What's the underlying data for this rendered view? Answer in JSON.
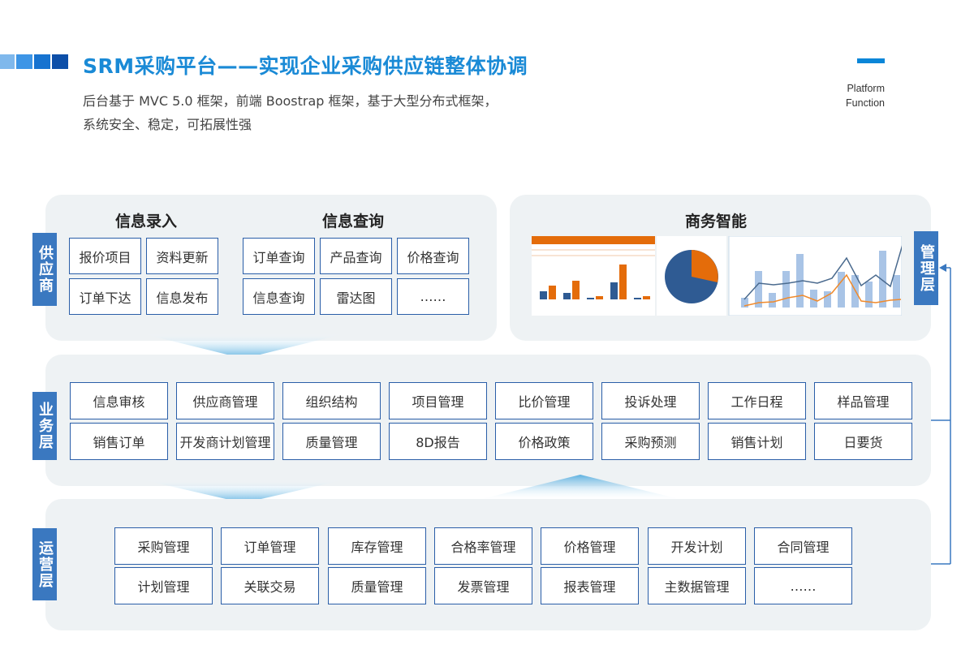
{
  "header": {
    "title": "SRM采购平台——实现企业采购供应链整体协调",
    "subtitle_lines": [
      "后台基于 MVC 5.0 框架，前端 Boostrap 框架，基于大型分布式框架，",
      "系统安全、稳定，可拓展性强"
    ],
    "platform_label": [
      "Platform",
      "Function"
    ],
    "accent": "#1a8ad6"
  },
  "supplier": {
    "label": "供应商",
    "entry": {
      "heading": "信息录入",
      "items": [
        "报价项目",
        "资料更新",
        "订单下达",
        "信息发布"
      ]
    },
    "query": {
      "heading": "信息查询",
      "items": [
        "订单查询",
        "产品查询",
        "价格查询",
        "信息查询",
        "雷达图",
        "……"
      ]
    }
  },
  "bi": {
    "heading": "商务智能"
  },
  "management": {
    "label": "管理层"
  },
  "business": {
    "label": "业务层",
    "items": [
      "信息审核",
      "供应商管理",
      "组织结构",
      "项目管理",
      "比价管理",
      "投诉处理",
      "工作日程",
      "样品管理",
      "销售订单",
      "开发商计划管理",
      "质量管理",
      "8D报告",
      "价格政策",
      "采购预测",
      "销售计划",
      "日要货"
    ]
  },
  "operations": {
    "label": "运营层",
    "items": [
      "采购管理",
      "订单管理",
      "库存管理",
      "合格率管理",
      "价格管理",
      "开发计划",
      "合同管理",
      "计划管理",
      "关联交易",
      "质量管理",
      "发票管理",
      "报表管理",
      "主数据管理",
      "……"
    ]
  },
  "colors": {
    "label_bg": "#3a78c0",
    "box_border": "#2a5ea8",
    "panel_bg": "#eef2f4",
    "chart_orange": "#e46c0a",
    "chart_blue": "#2f5b93"
  }
}
